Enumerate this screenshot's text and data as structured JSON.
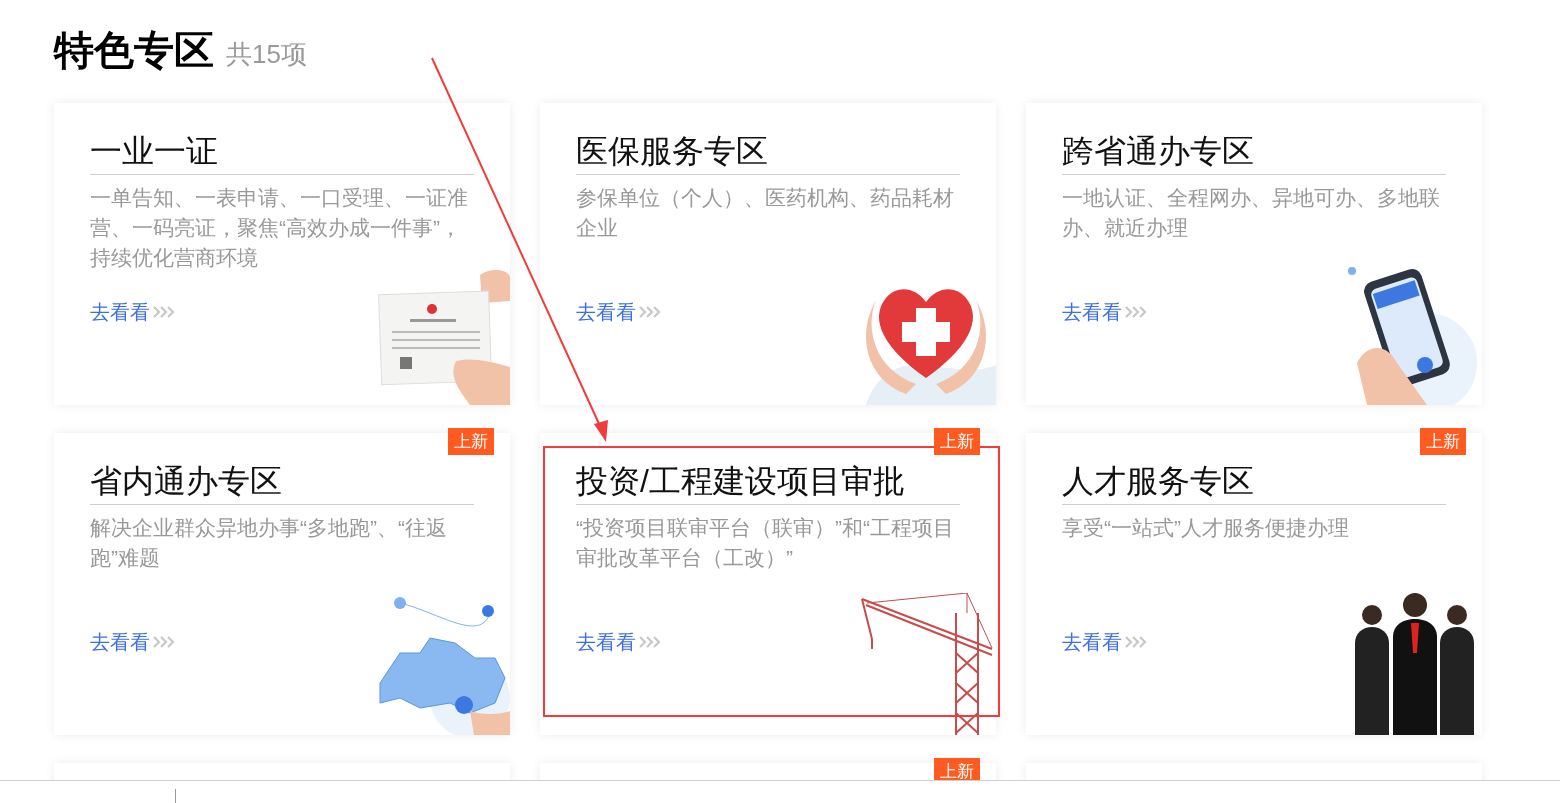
{
  "header": {
    "title": "特色专区",
    "count": "共15项"
  },
  "cards": [
    {
      "title": "一业一证",
      "description": "一单告知、一表申请、一口受理、一证准营、一码亮证，聚焦“高效办成一件事”，持续优化营商环境",
      "link": "去看看",
      "is_new": false,
      "highlighted": false,
      "kind": "certificate"
    },
    {
      "title": "医保服务专区",
      "description": "参保单位（个人）、医药机构、药品耗材企业",
      "link": "去看看",
      "is_new": false,
      "highlighted": false,
      "kind": "heart"
    },
    {
      "title": "跨省通办专区",
      "description": "一地认证、全程网办、异地可办、多地联办、就近办理",
      "link": "去看看",
      "is_new": false,
      "highlighted": false,
      "kind": "phone"
    },
    {
      "title": "省内通办专区",
      "description": "解决企业群众异地办事“多地跑”、“往返跑”难题",
      "link": "去看看",
      "is_new": true,
      "badge": "上新",
      "highlighted": false,
      "kind": "map"
    },
    {
      "title": "投资/工程建设项目审批",
      "description": "“投资项目联审平台（联审）”和“工程项目审批改革平台（工改）”",
      "link": "去看看",
      "is_new": true,
      "badge": "上新",
      "highlighted": true,
      "kind": "crane"
    },
    {
      "title": "人才服务专区",
      "description": "享受“一站式”人才服务便捷办理",
      "link": "去看看",
      "is_new": true,
      "badge": "上新",
      "highlighted": false,
      "kind": "people"
    },
    {
      "is_new": false,
      "highlighted": false
    },
    {
      "is_new": true,
      "badge": "上新",
      "highlighted": false
    },
    {
      "is_new": false,
      "highlighted": false
    }
  ]
}
